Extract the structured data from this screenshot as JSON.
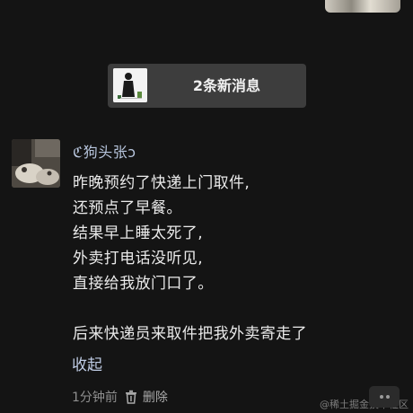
{
  "new_messages": {
    "label": "2条新消息"
  },
  "message": {
    "sender": "ℭ狗头张ↄ",
    "lines": [
      "昨晚预约了快递上门取件,",
      "还预点了早餐。",
      "结果早上睡太死了,",
      "外卖打电话没听见,",
      "直接给我放门口了。",
      "",
      "后来快递员来取件把我外卖寄走了"
    ],
    "collapse_label": "收起",
    "time": "1分钟前",
    "delete_label": "删除"
  },
  "watermark": "@稀土掘金技术社区",
  "icons": {
    "delete": "trash-icon",
    "more": "more-options-icon"
  },
  "colors": {
    "background": "#141414",
    "link": "#c0cde6",
    "username": "#b7c5dd"
  }
}
